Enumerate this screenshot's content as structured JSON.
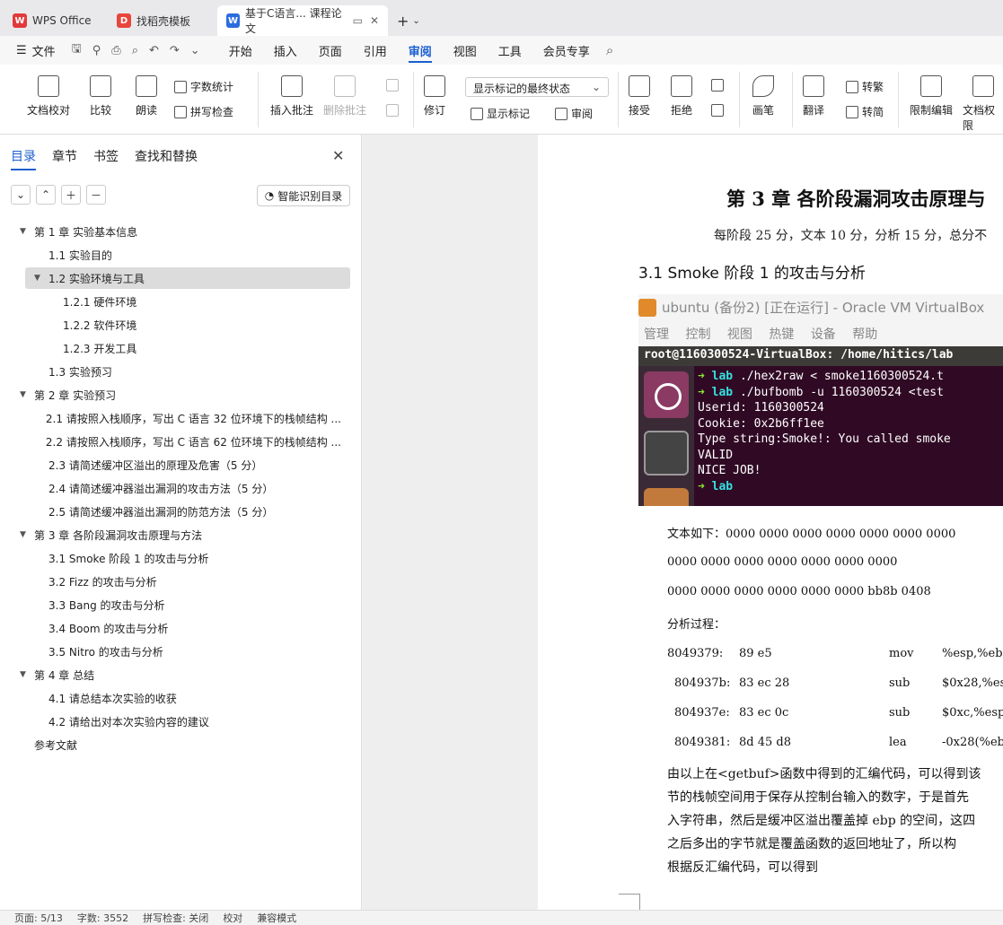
{
  "tabs": [
    {
      "label": "WPS Office",
      "icon": "wps-logo-icon"
    },
    {
      "label": "找稻壳模板",
      "icon": "docer-icon"
    },
    {
      "label": "基于C语言... 课程论文",
      "icon": "writer-doc-icon"
    }
  ],
  "menu": {
    "file": "文件",
    "items": [
      "开始",
      "插入",
      "页面",
      "引用",
      "审阅",
      "视图",
      "工具",
      "会员专享"
    ],
    "active": "审阅"
  },
  "ribbon": {
    "doc_check": "文档校对",
    "compare": "比较",
    "read_aloud": "朗读",
    "word_count": "字数统计",
    "spell_check": "拼写检查",
    "insert_comment": "插入批注",
    "delete_comment": "删除批注",
    "revise": "修订",
    "markup_select": "显示标记的最终状态",
    "show_markup": "显示标记",
    "review": "审阅",
    "accept": "接受",
    "reject": "拒绝",
    "pen": "画笔",
    "translate": "翻译",
    "to_traditional": "转繁",
    "to_simplified": "转简",
    "restrict_edit": "限制编辑",
    "doc_permission": "文档权限"
  },
  "nav": {
    "tabs": [
      "目录",
      "章节",
      "书签",
      "查找和替换"
    ],
    "smart_toc": "智能识别目录",
    "toc": [
      {
        "text": "第 1 章  实验基本信息",
        "level": 0,
        "expand": true
      },
      {
        "text": "1.1  实验目的",
        "level": 1
      },
      {
        "text": "1.2 实验环境与工具",
        "level": 1,
        "expand": true,
        "selected": true
      },
      {
        "text": "1.2.1  硬件环境",
        "level": 2
      },
      {
        "text": "1.2.2  软件环境",
        "level": 2
      },
      {
        "text": "1.2.3  开发工具",
        "level": 2
      },
      {
        "text": "1.3  实验预习",
        "level": 1
      },
      {
        "text": "第 2 章  实验预习",
        "level": 0,
        "expand": true
      },
      {
        "text": "2.1  请按照入栈顺序，写出 C 语言 32 位环境下的栈帧结构 ...",
        "level": 1
      },
      {
        "text": "2.2 请按照入栈顺序，写出 C 语言 62 位环境下的栈帧结构 ...",
        "level": 1
      },
      {
        "text": "2.3 请简述缓冲区溢出的原理及危害（5 分）",
        "level": 1
      },
      {
        "text": "2.4 请简述缓冲器溢出漏洞的攻击方法（5 分）",
        "level": 1
      },
      {
        "text": "2.5 请简述缓冲器溢出漏洞的防范方法（5 分）",
        "level": 1
      },
      {
        "text": "第 3 章  各阶段漏洞攻击原理与方法",
        "level": 0,
        "expand": true
      },
      {
        "text": "3.1 Smoke 阶段 1 的攻击与分析",
        "level": 1
      },
      {
        "text": "3.2 Fizz 的攻击与分析",
        "level": 1
      },
      {
        "text": "3.3 Bang 的攻击与分析",
        "level": 1
      },
      {
        "text": "3.4 Boom 的攻击与分析",
        "level": 1
      },
      {
        "text": "3.5 Nitro 的攻击与分析",
        "level": 1
      },
      {
        "text": "第 4 章  总结",
        "level": 0,
        "expand": true
      },
      {
        "text": "4.1  请总结本次实验的收获",
        "level": 1
      },
      {
        "text": "4.2  请给出对本次实验内容的建议",
        "level": 1
      },
      {
        "text": "参考文献",
        "level": 0
      }
    ]
  },
  "doc": {
    "chapter_title": "第 3 章  各阶段漏洞攻击原理与",
    "score_note": "每阶段 25 分，文本 10 分，分析 15 分，总分不",
    "section_title": "3.1  Smoke 阶段 1 的攻击与分析",
    "vm": {
      "title": "ubuntu (备份2) [正在运行] - Oracle VM VirtualBox",
      "menu": [
        "管理",
        "控制",
        "视图",
        "热键",
        "设备",
        "帮助"
      ],
      "terminal_title": "root@1160300524-VirtualBox: /home/hitics/lab",
      "lines": [
        {
          "arrow": "➜",
          "dir": "lab",
          "cmd": " ./hex2raw < smoke1160300524.t"
        },
        {
          "arrow": "➜",
          "dir": "lab",
          "cmd": " ./bufbomb -u 1160300524 <test"
        },
        {
          "text": "Userid: 1160300524"
        },
        {
          "text": "Cookie: 0x2b6ff1ee"
        },
        {
          "text": "Type string:Smoke!: You called smoke"
        },
        {
          "text": "VALID"
        },
        {
          "text": "NICE JOB!"
        },
        {
          "arrow": "➜",
          "dir": "lab",
          "cmd": ""
        }
      ]
    },
    "text_line1": "文本如下：0000 0000 0000 0000 0000 0000 0000",
    "text_line2": "0000 0000 0000 0000 0000 0000 0000",
    "text_line3": "0000 0000 0000 0000 0000 0000 bb8b 0408",
    "analysis_label": "分析过程：",
    "asm": [
      {
        "addr": "8049379:",
        "bytes": "89 e5",
        "op": "mov",
        "args": "%esp,%eb"
      },
      {
        "addr": "804937b:",
        "bytes": "83 ec 28",
        "op": "sub",
        "args": "$0x28,%es"
      },
      {
        "addr": "804937e:",
        "bytes": "83 ec 0c",
        "op": "sub",
        "args": "$0xc,%esp"
      },
      {
        "addr": "8049381:",
        "bytes": "8d 45 d8",
        "op": "lea",
        "args": "-0x28(%ebp"
      }
    ],
    "body": [
      "由以上在<getbuf>函数中得到的汇编代码，可以得到该",
      "节的栈帧空间用于保存从控制台输入的数字，于是首先",
      "入字符串，然后是缓冲区溢出覆盖掉 ebp 的空间，这四",
      "之后多出的字节就是覆盖函数的返回地址了，所以构",
      "根据反汇编代码，可以得到"
    ]
  },
  "status": {
    "page": "页面: 5/13",
    "words": "字数: 3552",
    "spell": "拼写检查: 关闭",
    "proof": "校对",
    "compat": "兼容模式"
  }
}
